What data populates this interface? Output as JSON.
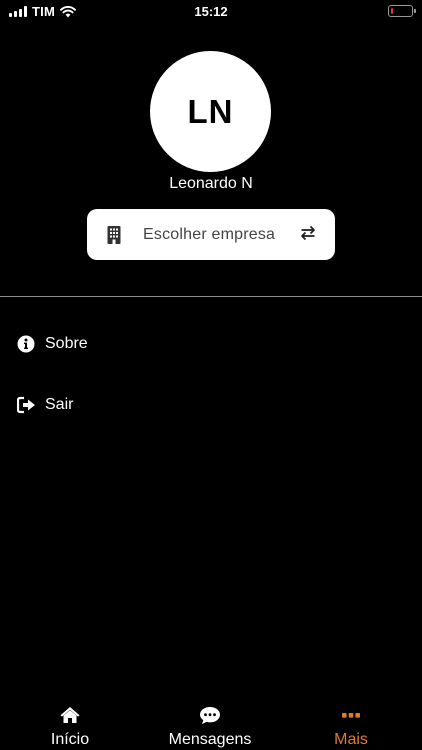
{
  "status_bar": {
    "carrier": "TIM",
    "time": "15:12",
    "battery_level": 0.1,
    "battery_color": "#e8322f"
  },
  "profile": {
    "initials": "LN",
    "name": "Leonardo N"
  },
  "company_selector": {
    "label": "Escolher empresa",
    "icon": "building-icon",
    "action_icon": "swap-arrows-icon"
  },
  "menu": {
    "items": [
      {
        "label": "Sobre",
        "icon": "info-circle-icon"
      },
      {
        "label": "Sair",
        "icon": "sign-out-icon"
      }
    ]
  },
  "tab_bar": {
    "active_color": "#e07a2e",
    "tabs": [
      {
        "label": "Início",
        "icon": "home-icon",
        "active": false
      },
      {
        "label": "Mensagens",
        "icon": "chat-bubble-icon",
        "active": false
      },
      {
        "label": "Mais",
        "icon": "more-dots-icon",
        "active": true
      }
    ]
  }
}
